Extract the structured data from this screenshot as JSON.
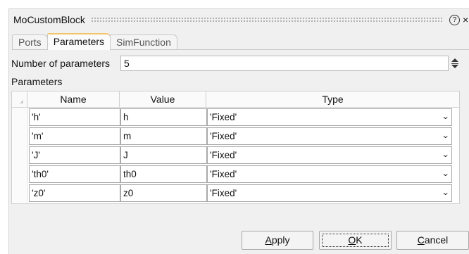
{
  "window": {
    "title": "MoCustomBlock",
    "help_glyph": "?",
    "close_glyph": "×"
  },
  "tabs": [
    {
      "label": "Ports",
      "active": false
    },
    {
      "label": "Parameters",
      "active": true
    },
    {
      "label": "SimFunction",
      "active": false
    }
  ],
  "nparams": {
    "label": "Number of parameters",
    "value": "5"
  },
  "params": {
    "label": "Parameters",
    "headers": {
      "name": "Name",
      "value": "Value",
      "type": "Type"
    },
    "rows": [
      {
        "name": "'h'",
        "value": "h",
        "type": "'Fixed'"
      },
      {
        "name": "'m'",
        "value": "m",
        "type": "'Fixed'"
      },
      {
        "name": "'J'",
        "value": "J",
        "type": "'Fixed'"
      },
      {
        "name": "'th0'",
        "value": "th0",
        "type": "'Fixed'"
      },
      {
        "name": "'z0'",
        "value": "z0",
        "type": "'Fixed'"
      }
    ]
  },
  "buttons": {
    "apply": {
      "first": "A",
      "rest": "pply"
    },
    "ok": {
      "first": "O",
      "rest": "K"
    },
    "cancel": {
      "first": "C",
      "rest": "ancel"
    }
  },
  "colors": {
    "active_tab_accent": "#f3c56a",
    "dialog_bg": "#f0f0f0"
  }
}
